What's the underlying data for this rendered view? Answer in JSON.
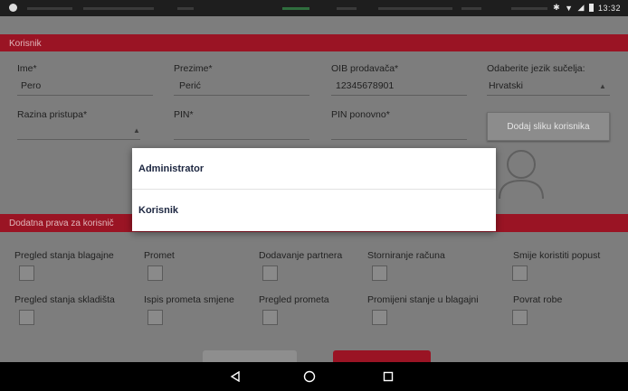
{
  "status_bar": {
    "time": "13:32"
  },
  "section_user": {
    "title": "Korisnik"
  },
  "fields": {
    "first_name": {
      "label": "Ime*",
      "value": "Pero"
    },
    "last_name": {
      "label": "Prezime*",
      "value": "Perić"
    },
    "oib": {
      "label": "OIB prodavača*",
      "value": "12345678901"
    },
    "language": {
      "label": "Odaberite jezik sučelja:",
      "value": "Hrvatski"
    },
    "access_level": {
      "label": "Razina pristupa*",
      "value": ""
    },
    "pin": {
      "label": "PIN*",
      "value": ""
    },
    "pin_repeat": {
      "label": "PIN ponovno*",
      "value": ""
    }
  },
  "add_photo_button": "Dodaj sliku korisnika",
  "section_rights": {
    "title": "Dodatna prava za korisnič"
  },
  "permissions": [
    {
      "label": "Pregled stanja blagajne"
    },
    {
      "label": "Promet"
    },
    {
      "label": "Dodavanje partnera"
    },
    {
      "label": "Storniranje računa"
    },
    {
      "label": "Smije koristiti popust"
    },
    {
      "label": "Pregled stanja skladišta"
    },
    {
      "label": "Ispis prometa smjene"
    },
    {
      "label": "Pregled prometa"
    },
    {
      "label": "Promijeni stanje u blagajni"
    },
    {
      "label": "Povrat robe"
    }
  ],
  "dropdown": {
    "options": [
      {
        "label": "Administrator"
      },
      {
        "label": "Korisnik"
      }
    ]
  },
  "colors": {
    "accent": "#9a1424",
    "overlay": "#7d7d7d"
  }
}
